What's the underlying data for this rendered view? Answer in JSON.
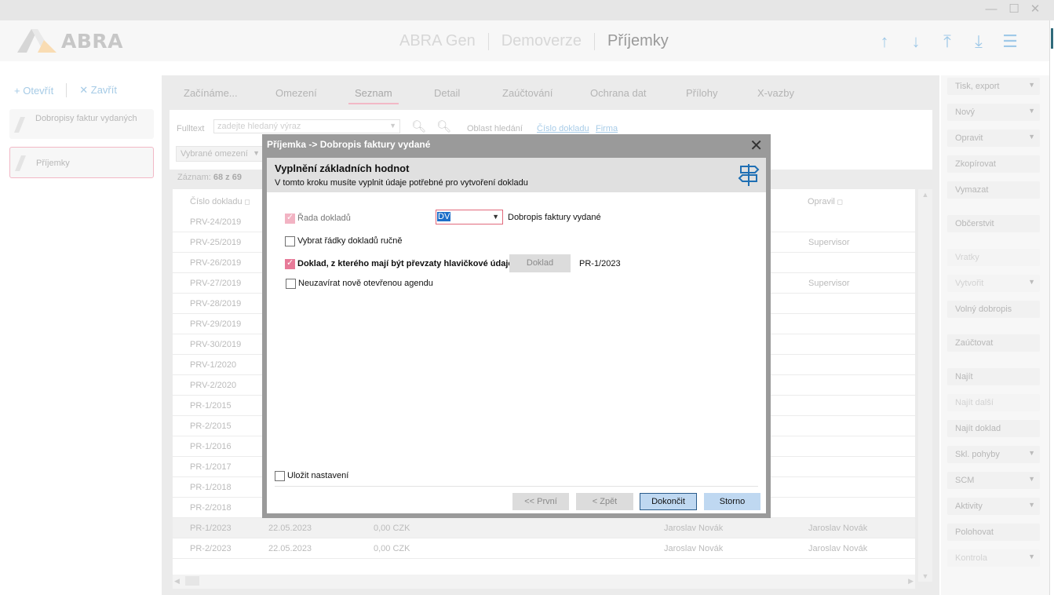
{
  "window": {
    "minimize": "—",
    "maximize": "☐",
    "close": "✕"
  },
  "app": {
    "logo_text": "ABRA",
    "breadcrumbs": [
      "ABRA Gen",
      "Demoverze",
      "Příjemky"
    ]
  },
  "sidebar": {
    "open_label": "Otevřít",
    "close_label": "Zavřít",
    "items": [
      {
        "label": "Dobropisy faktur vydaných"
      },
      {
        "label": "Příjemky"
      }
    ]
  },
  "tabs": [
    "Začínáme...",
    "Omezení",
    "Seznam",
    "Detail",
    "Zaúčtování",
    "Ochrana dat",
    "Přílohy",
    "X-vazby"
  ],
  "filter": {
    "fulltext_label": "Fulltext",
    "fulltext_placeholder": "zadejte hledaný výraz",
    "area_label": "Oblast hledání",
    "area_links": [
      "Číslo dokladu",
      "Firma"
    ],
    "restriction_label": "Vybrané omezení"
  },
  "records": {
    "label": "Záznam:",
    "value": "68 z 69"
  },
  "grid": {
    "columns": [
      "Číslo dokladu",
      "Opravil"
    ],
    "rows": [
      {
        "doc": "PRV-24/2019",
        "date": "",
        "amount": "",
        "created": "",
        "modified": ""
      },
      {
        "doc": "PRV-25/2019",
        "date": "",
        "amount": "",
        "created": "",
        "modified": "Supervisor"
      },
      {
        "doc": "PRV-26/2019",
        "date": "",
        "amount": "",
        "created": "",
        "modified": ""
      },
      {
        "doc": "PRV-27/2019",
        "date": "",
        "amount": "",
        "created": "",
        "modified": "Supervisor"
      },
      {
        "doc": "PRV-28/2019",
        "date": "",
        "amount": "",
        "created": "",
        "modified": ""
      },
      {
        "doc": "PRV-29/2019",
        "date": "",
        "amount": "",
        "created": "",
        "modified": ""
      },
      {
        "doc": "PRV-30/2019",
        "date": "",
        "amount": "",
        "created": "",
        "modified": ""
      },
      {
        "doc": "PRV-1/2020",
        "date": "",
        "amount": "",
        "created": "",
        "modified": ""
      },
      {
        "doc": "PRV-2/2020",
        "date": "",
        "amount": "",
        "created": "",
        "modified": ""
      },
      {
        "doc": "PR-1/2015",
        "date": "",
        "amount": "",
        "created": "",
        "modified": ""
      },
      {
        "doc": "PR-2/2015",
        "date": "",
        "amount": "",
        "created": "",
        "modified": ""
      },
      {
        "doc": "PR-1/2016",
        "date": "",
        "amount": "",
        "created": "",
        "modified": ""
      },
      {
        "doc": "PR-1/2017",
        "date": "",
        "amount": "",
        "created": "",
        "modified": ""
      },
      {
        "doc": "PR-1/2018",
        "date": "",
        "amount": "",
        "created": "",
        "modified": ""
      },
      {
        "doc": "PR-2/2018",
        "date": "",
        "amount": "",
        "created": "",
        "modified": ""
      },
      {
        "doc": "PR-1/2023",
        "date": "22.05.2023",
        "amount": "0,00 CZK",
        "created": "Jaroslav Novák",
        "modified": "Jaroslav Novák",
        "selected": true
      },
      {
        "doc": "PR-2/2023",
        "date": "22.05.2023",
        "amount": "0,00 CZK",
        "created": "Jaroslav Novák",
        "modified": "Jaroslav Novák"
      }
    ]
  },
  "actions": [
    {
      "label": "Tisk, export",
      "dropdown": true,
      "enabled": true
    },
    {
      "label": "Nový",
      "dropdown": true,
      "enabled": true
    },
    {
      "label": "Opravit",
      "dropdown": true,
      "enabled": true
    },
    {
      "label": "Zkopírovat",
      "dropdown": false,
      "enabled": true
    },
    {
      "label": "Vymazat",
      "dropdown": false,
      "enabled": true
    },
    {
      "label": "Občerstvit",
      "dropdown": false,
      "enabled": true
    },
    {
      "label": "Vratky",
      "dropdown": false,
      "enabled": false
    },
    {
      "label": "Vytvořit",
      "dropdown": true,
      "enabled": false
    },
    {
      "label": "Volný dobropis",
      "dropdown": false,
      "enabled": true
    },
    {
      "label": "Zaúčtovat",
      "dropdown": false,
      "enabled": true
    },
    {
      "label": "Najít",
      "dropdown": false,
      "enabled": true
    },
    {
      "label": "Najít další",
      "dropdown": false,
      "enabled": false
    },
    {
      "label": "Najít doklad",
      "dropdown": false,
      "enabled": true
    },
    {
      "label": "Skl. pohyby",
      "dropdown": true,
      "enabled": true
    },
    {
      "label": "SCM",
      "dropdown": true,
      "enabled": true
    },
    {
      "label": "Aktivity",
      "dropdown": true,
      "enabled": true
    },
    {
      "label": "Polohovat",
      "dropdown": false,
      "enabled": true
    },
    {
      "label": "Kontrola",
      "dropdown": true,
      "enabled": false
    }
  ],
  "dialog": {
    "title": "Příjemka -> Dobropis faktury vydané",
    "header_title": "Vyplnění základních hodnot",
    "header_subtitle": "V tomto kroku musíte vyplnit údaje potřebné pro vytvoření dokladu",
    "series_label": "Řada dokladů",
    "series_value": "DV",
    "series_desc": "Dobropis faktury vydané",
    "pick_rows_label": "Vybrat řádky dokladů ručně",
    "source_doc_label": "Doklad, z kterého mají být převzaty hlavičkové údaje",
    "source_doc_button": "Doklad",
    "source_doc_value": "PR-1/2023",
    "keep_open_label": "Neuzavírat nově otevřenou agendu",
    "save_settings_label": "Uložit nastavení",
    "buttons": {
      "first": "<< První",
      "back": "< Zpět",
      "finish": "Dokončit",
      "cancel": "Storno"
    }
  }
}
